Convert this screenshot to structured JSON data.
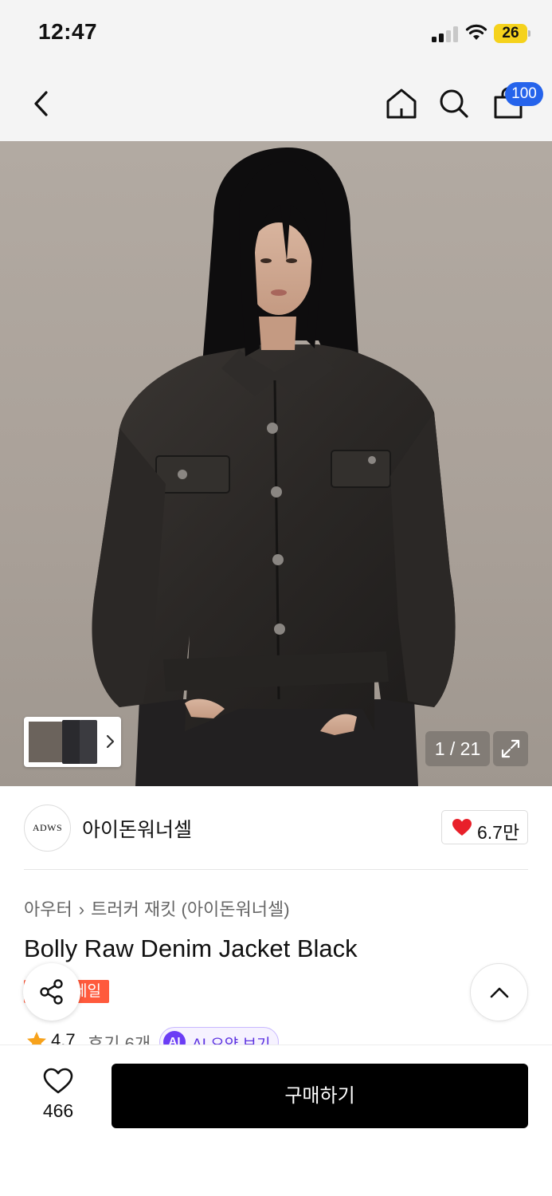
{
  "status_bar": {
    "time": "12:47",
    "battery": "26",
    "battery_color": "#f5d21c"
  },
  "nav": {
    "back_icon": "chevron-left-icon",
    "home_icon": "home-icon",
    "search_icon": "search-icon",
    "cart_icon": "shopping-bag-icon",
    "cart_badge": "100",
    "badge_color": "#2563eb"
  },
  "gallery": {
    "counter": "1 / 21",
    "expand_icon": "expand-icon",
    "thumbnails_next_icon": "chevron-right-icon"
  },
  "brand": {
    "logo_text": "ADWS",
    "name": "아이돈워너셀",
    "likes": "6.7만",
    "heart_color": "#e8202a"
  },
  "product": {
    "breadcrumb": [
      "아우터",
      "트러커 재킷 (아이돈워너셀)"
    ],
    "name": "Bolly Raw Denim Jacket Black",
    "sale_badge": "세일",
    "sale_color": "#ff5a3c",
    "rating": "4.7",
    "reviews": "후기 6개",
    "ai_icon": "AI",
    "ai_summary": "AI 요약 보기"
  },
  "floating": {
    "share_icon": "share-icon",
    "top_icon": "chevron-up-icon"
  },
  "bottom_bar": {
    "wish_count": "466",
    "buy_label": "구매하기"
  }
}
